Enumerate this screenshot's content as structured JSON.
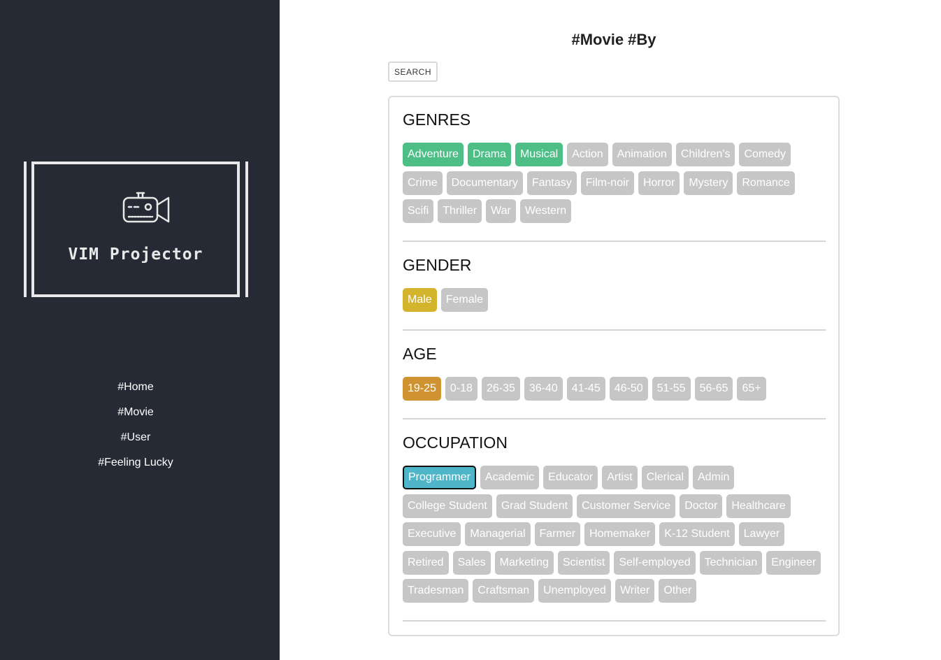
{
  "sidebar": {
    "logo_title": "VIM Projector",
    "logo_icon": "projector-icon",
    "nav": [
      "#Home",
      "#Movie",
      "#User",
      "#Feeling Lucky"
    ]
  },
  "main": {
    "title": "#Movie #By",
    "search_label": "SEARCH"
  },
  "colors": {
    "sidebar_bg": "#252a34",
    "tag_inactive": "#c6c6c6",
    "genre_active": "#4cbe86",
    "gender_active": "#d4b42c",
    "age_active": "#cf9331",
    "occupation_active": "#4fb5c9"
  },
  "sections": {
    "genres": {
      "title": "GENRES",
      "selected": [
        "Adventure",
        "Drama",
        "Musical"
      ],
      "rows": [
        [
          "Adventure",
          "Drama",
          "Musical",
          "Action",
          "Animation",
          "Children's",
          "Comedy"
        ],
        [
          "Crime",
          "Documentary",
          "Fantasy",
          "Film-noir",
          "Horror",
          "Mystery",
          "Romance"
        ],
        [
          "Scifi",
          "Thriller",
          "War",
          "Western"
        ]
      ]
    },
    "gender": {
      "title": "GENDER",
      "selected": [
        "Male"
      ],
      "rows": [
        [
          "Male",
          "Female"
        ]
      ]
    },
    "age": {
      "title": "AGE",
      "selected": [
        "19-25"
      ],
      "rows": [
        [
          "19-25",
          "0-18",
          "26-35",
          "36-40",
          "41-45",
          "46-50",
          "51-55",
          "56-65",
          "65+"
        ]
      ]
    },
    "occupation": {
      "title": "OCCUPATION",
      "selected": [
        "Programmer"
      ],
      "rows": [
        [
          "Programmer",
          "Academic",
          "Educator",
          "Artist",
          "Clerical",
          "Admin"
        ],
        [
          "College Student",
          "Grad Student",
          "Customer Service",
          "Doctor",
          "Healthcare"
        ],
        [
          "Executive",
          "Managerial",
          "Farmer",
          "Homemaker",
          "K-12 Student",
          "Lawyer"
        ],
        [
          "Retired",
          "Sales",
          "Marketing",
          "Scientist",
          "Self-employed",
          "Technician",
          "Engineer"
        ],
        [
          "Tradesman",
          "Craftsman",
          "Unemployed",
          "Writer",
          "Other"
        ]
      ]
    }
  }
}
